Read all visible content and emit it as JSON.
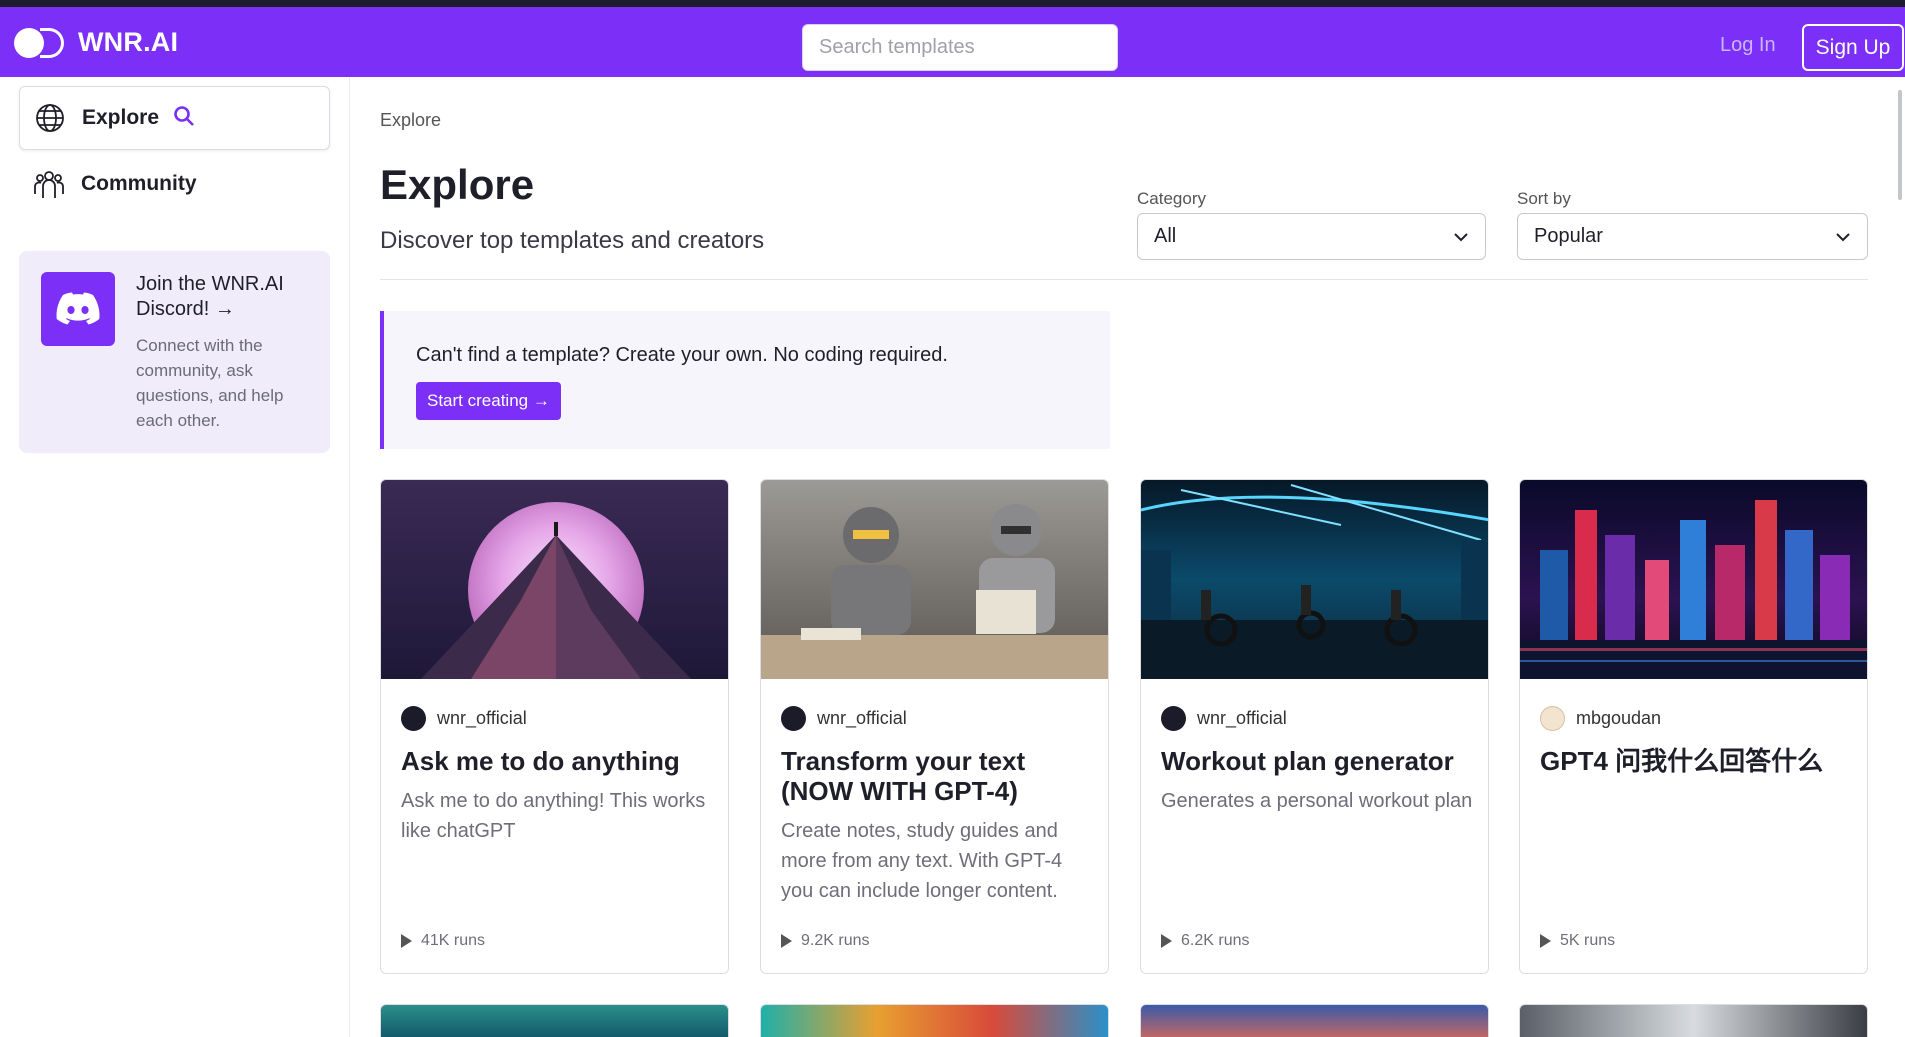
{
  "header": {
    "brand": "WNR.AI",
    "search_placeholder": "Search templates",
    "login": "Log In",
    "signup": "Sign Up"
  },
  "sidebar": {
    "items": [
      {
        "label": "Explore",
        "icon": "globe-icon",
        "active": true
      },
      {
        "label": "Community",
        "icon": "community-icon",
        "active": false
      }
    ],
    "discord": {
      "title": "Join the WNR.AI Discord! →",
      "description": "Connect with the community, ask questions, and help each other."
    }
  },
  "main": {
    "breadcrumb": "Explore",
    "title": "Explore",
    "subtitle": "Discover top templates and creators",
    "category": {
      "label": "Category",
      "value": "All"
    },
    "sort": {
      "label": "Sort by",
      "value": "Popular"
    },
    "callout": {
      "text": "Can't find a template? Create your own. No coding required.",
      "button": "Start creating →"
    }
  },
  "cards": [
    {
      "author": "wnr_official",
      "title": "Ask me to do anything",
      "description": "Ask me to do anything! This works like chatGPT",
      "runs": "41K runs",
      "thumb": "mountain-moon"
    },
    {
      "author": "wnr_official",
      "title": "Transform your text (NOW WITH GPT-4)",
      "description": "Create notes, study guides and more from any text. With GPT-4 you can include longer content.",
      "runs": "9.2K runs",
      "thumb": "robots-reading"
    },
    {
      "author": "wnr_official",
      "title": "Workout plan generator",
      "description": "Generates a personal workout plan",
      "runs": "6.2K runs",
      "thumb": "neon-gym"
    },
    {
      "author": "mbgoudan",
      "title": "GPT4 问我什么回答什么",
      "description": "",
      "runs": "5K runs",
      "thumb": "neon-city"
    }
  ],
  "colors": {
    "accent": "#7b2ff7",
    "navbar": "#7b2ff7"
  }
}
